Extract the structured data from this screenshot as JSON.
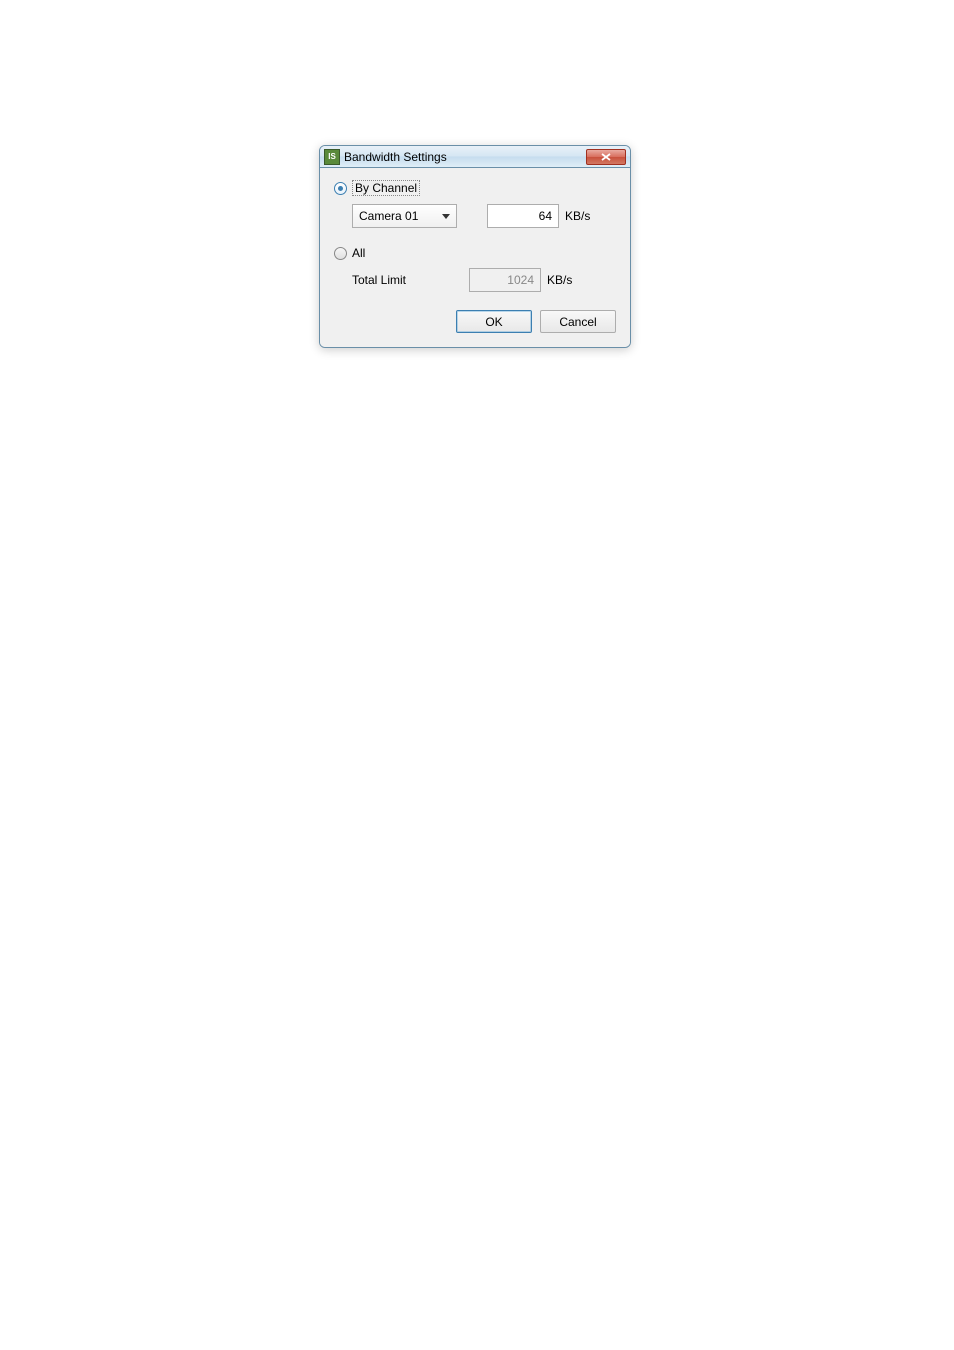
{
  "dialog": {
    "title": "Bandwidth Settings",
    "radio_by_channel": {
      "label": "By Channel",
      "selected": true
    },
    "channel_select": {
      "value": "Camera 01"
    },
    "channel_limit": {
      "value": "64",
      "unit": "KB/s"
    },
    "radio_all": {
      "label": "All",
      "selected": false
    },
    "total_limit": {
      "label": "Total Limit",
      "value": "1024",
      "unit": "KB/s"
    },
    "buttons": {
      "ok": "OK",
      "cancel": "Cancel"
    }
  }
}
